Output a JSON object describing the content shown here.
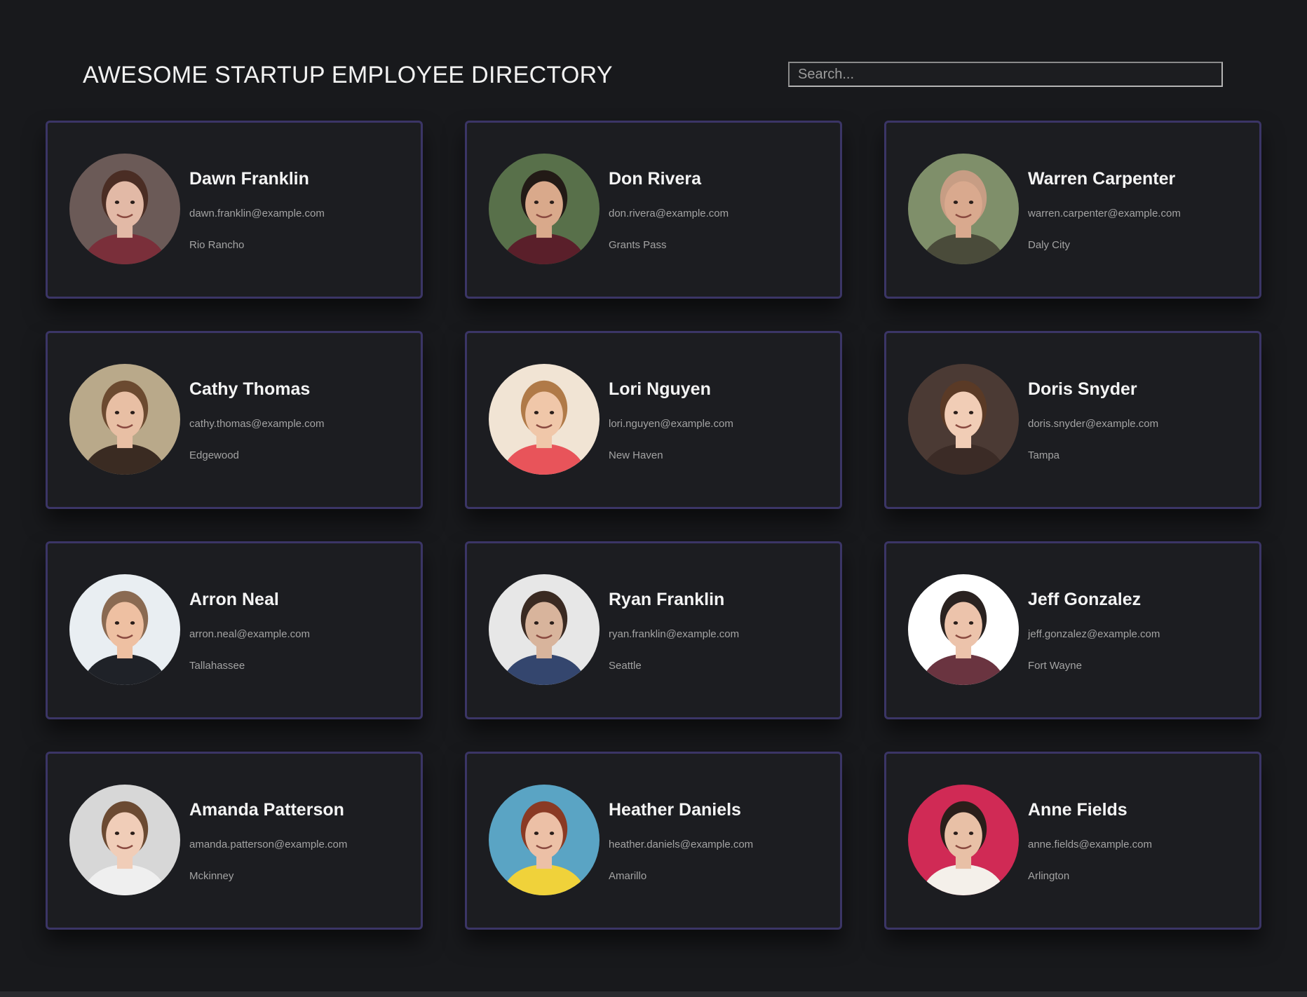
{
  "header": {
    "title": "AWESOME STARTUP EMPLOYEE DIRECTORY",
    "search_placeholder": "Search..."
  },
  "employees": [
    {
      "name": "Dawn Franklin",
      "email": "dawn.franklin@example.com",
      "city": "Rio Rancho",
      "photo_colors": {
        "bg": "#6b5a57",
        "skin": "#e2b9a6",
        "hair": "#4a2d24",
        "shirt": "#7a2f3a"
      }
    },
    {
      "name": "Don Rivera",
      "email": "don.rivera@example.com",
      "city": "Grants Pass",
      "photo_colors": {
        "bg": "#58704a",
        "skin": "#d9a98b",
        "hair": "#221a16",
        "shirt": "#5a1f2a"
      }
    },
    {
      "name": "Warren Carpenter",
      "email": "warren.carpenter@example.com",
      "city": "Daly City",
      "photo_colors": {
        "bg": "#7f8f6a",
        "skin": "#d9a98e",
        "hair": "#c79d84",
        "shirt": "#4a4b3a"
      }
    },
    {
      "name": "Cathy Thomas",
      "email": "cathy.thomas@example.com",
      "city": "Edgewood",
      "photo_colors": {
        "bg": "#b9a98a",
        "skin": "#e8bfa4",
        "hair": "#6b4a30",
        "shirt": "#3a2b22"
      }
    },
    {
      "name": "Lori Nguyen",
      "email": "lori.nguyen@example.com",
      "city": "New Haven",
      "photo_colors": {
        "bg": "#f1e4d4",
        "skin": "#f0c7a9",
        "hair": "#b07a48",
        "shirt": "#e8545a"
      }
    },
    {
      "name": "Doris Snyder",
      "email": "doris.snyder@example.com",
      "city": "Tampa",
      "photo_colors": {
        "bg": "#4b3a34",
        "skin": "#f1cdb6",
        "hair": "#5a3a26",
        "shirt": "#3b2b26"
      }
    },
    {
      "name": "Arron Neal",
      "email": "arron.neal@example.com",
      "city": "Tallahassee",
      "photo_colors": {
        "bg": "#e9eef2",
        "skin": "#eec0a2",
        "hair": "#8a6a52",
        "shirt": "#1f2228"
      }
    },
    {
      "name": "Ryan Franklin",
      "email": "ryan.franklin@example.com",
      "city": "Seattle",
      "photo_colors": {
        "bg": "#e7e7e7",
        "skin": "#d8b49c",
        "hair": "#3a2a22",
        "shirt": "#34466e"
      }
    },
    {
      "name": "Jeff Gonzalez",
      "email": "jeff.gonzalez@example.com",
      "city": "Fort Wayne",
      "photo_colors": {
        "bg": "#ffffff",
        "skin": "#ecc3ab",
        "hair": "#2a2220",
        "shirt": "#6a3440"
      }
    },
    {
      "name": "Amanda Patterson",
      "email": "amanda.patterson@example.com",
      "city": "Mckinney",
      "photo_colors": {
        "bg": "#d7d7d7",
        "skin": "#f0cdb8",
        "hair": "#6b4a32",
        "shirt": "#efefef"
      }
    },
    {
      "name": "Heather Daniels",
      "email": "heather.daniels@example.com",
      "city": "Amarillo",
      "photo_colors": {
        "bg": "#5aa4c4",
        "skin": "#ecc0a6",
        "hair": "#8a3a24",
        "shirt": "#f0d23a"
      }
    },
    {
      "name": "Anne Fields",
      "email": "anne.fields@example.com",
      "city": "Arlington",
      "photo_colors": {
        "bg": "#d02a55",
        "skin": "#e8c0a6",
        "hair": "#2a1e1a",
        "shirt": "#f4f0ea"
      }
    }
  ]
}
